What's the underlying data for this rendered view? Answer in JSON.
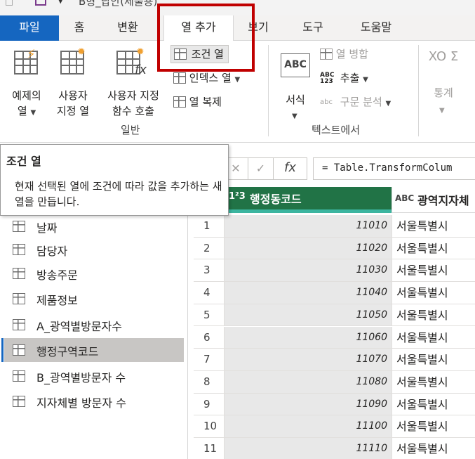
{
  "title": "B형_답안(제출용)",
  "tabs": [
    {
      "label": "파일",
      "active": false
    },
    {
      "label": "홈",
      "active": false
    },
    {
      "label": "변환",
      "active": false
    },
    {
      "label": "열 추가",
      "active": true
    },
    {
      "label": "보기",
      "active": false
    },
    {
      "label": "도구",
      "active": false
    },
    {
      "label": "도움말",
      "active": false
    }
  ],
  "ribbon": {
    "example_column": {
      "line1": "예제의",
      "line2": "열"
    },
    "custom_column": {
      "line1": "사용자",
      "line2": "지정 열"
    },
    "invoke_function": {
      "line1": "사용자 지정",
      "line2": "함수 호출"
    },
    "conditional_column": "조건 열",
    "index_column": "인덱스 열",
    "duplicate_column": "열 복제",
    "group_general": "일반",
    "format": "서식",
    "merge_columns": "열 병합",
    "extract": "추출",
    "parse": "구문 분석",
    "group_text": "텍스트에서",
    "statistics": "통계",
    "format_icon_text": "ABC",
    "extract_icon_text": "ABC\n123",
    "parse_icon_text": "abc",
    "stats_icon_text": "XO Σ"
  },
  "tooltip": {
    "title": "조건 열",
    "body": "현재 선택된 열에 조건에 따라 값을 추가하는 새 열을 만듭니다."
  },
  "formula": {
    "text": "= Table.TransformColum",
    "fx": "fx",
    "cancel": "✕",
    "confirm": "✓"
  },
  "queries": [
    {
      "label": "날짜",
      "selected": false
    },
    {
      "label": "담당자",
      "selected": false
    },
    {
      "label": "방송주문",
      "selected": false
    },
    {
      "label": "제품정보",
      "selected": false
    },
    {
      "label": "A_광역별방문자수",
      "selected": false
    },
    {
      "label": "행정구역코드",
      "selected": true
    },
    {
      "label": "B_광역별방문자 수",
      "selected": false
    },
    {
      "label": "지자체별 방문자 수",
      "selected": false
    }
  ],
  "grid": {
    "columns": [
      {
        "type_icon": "1²3",
        "name": "행정동코드"
      },
      {
        "type_icon": "ABC",
        "name": "광역지자체"
      }
    ],
    "rows": [
      {
        "n": "1",
        "code": "11010",
        "region": "서울특별시"
      },
      {
        "n": "2",
        "code": "11020",
        "region": "서울특별시"
      },
      {
        "n": "3",
        "code": "11030",
        "region": "서울특별시"
      },
      {
        "n": "4",
        "code": "11040",
        "region": "서울특별시"
      },
      {
        "n": "5",
        "code": "11050",
        "region": "서울특별시"
      },
      {
        "n": "6",
        "code": "11060",
        "region": "서울특별시"
      },
      {
        "n": "7",
        "code": "11070",
        "region": "서울특별시"
      },
      {
        "n": "8",
        "code": "11080",
        "region": "서울특별시"
      },
      {
        "n": "9",
        "code": "11090",
        "region": "서울특별시"
      },
      {
        "n": "10",
        "code": "11100",
        "region": "서울특별시"
      },
      {
        "n": "11",
        "code": "11110",
        "region": "서울특별시"
      }
    ]
  },
  "colors": {
    "file_tab": "#1566c0",
    "column_header": "#217346",
    "highlight_border": "#c00000",
    "selected_query": "#c8c6c4"
  }
}
